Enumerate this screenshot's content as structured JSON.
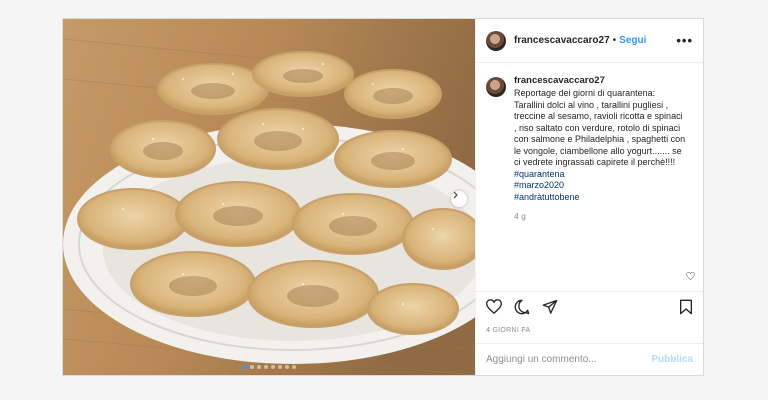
{
  "post": {
    "username": "francescavaccaro27",
    "separator": "•",
    "follow_label": "Segui",
    "more_icon": "more-horizontal-icon",
    "more_label": "•••",
    "caption": {
      "username": "francescavaccaro27",
      "text": "Reportage dei giorni di quarantena: Tarallini dolci al vino , tarallini pugliesi , treccine al sesamo, ravioli ricotta e spinaci , riso saltato con verdure, rotolo di spinaci con salmone e Philadelphia , spaghetti con le vongole, ciambellone allo yogurt....... se ci vedrete ingrassati capirete il perchè!!!!",
      "hashtags": [
        "#quarantena",
        "#marzo2020",
        "#andràtuttobene"
      ],
      "time_ago": "4 g"
    },
    "date_label": "4 GIORNI FA",
    "comment": {
      "placeholder": "Aggiungi un commento...",
      "publish_label": "Pubblica"
    },
    "carousel": {
      "count": 8,
      "active_index": 0
    },
    "icons": [
      "heart-icon",
      "comment-icon",
      "share-icon",
      "bookmark-icon"
    ]
  },
  "colors": {
    "link_blue": "#3897f0",
    "publish_disabled": "#b3dbff",
    "hashtag": "#00376b",
    "muted": "#8e8e8e"
  }
}
